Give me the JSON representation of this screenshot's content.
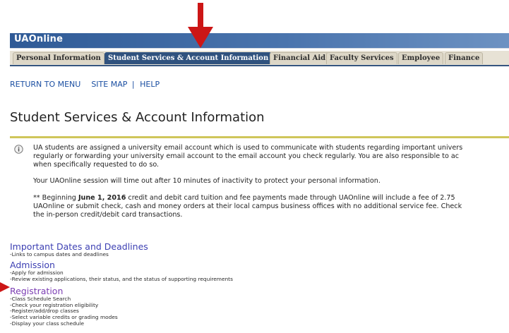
{
  "app": {
    "brand": "UAOnline"
  },
  "tabs": [
    {
      "label": "Personal Information"
    },
    {
      "label": "Student Services & Account Information"
    },
    {
      "label": "Financial Aid"
    },
    {
      "label": "Faculty Services"
    },
    {
      "label": "Employee"
    },
    {
      "label": "Finance"
    }
  ],
  "nav": {
    "return": "RETURN TO MENU",
    "sitemap": "SITE MAP",
    "divider": "|",
    "help": "HELP"
  },
  "page": {
    "title": "Student Services & Account Information"
  },
  "info": {
    "line1": "UA students are assigned a university email account which is used to communicate with students regarding important univers",
    "line2": "regularly or forwarding your university email account to the email account you check regularly. You are also responsible to ac",
    "line3": "when specifically requested to do so.",
    "timeout": "Your UAOnline session will time out after 10 minutes of inactivity to protect your personal information.",
    "notice_pre": "** Beginning ",
    "notice_date": "June 1, 2016",
    "notice_post": " credit and debit card tuition and fee payments made through UAOnline will include a fee of 2.75",
    "notice_line2": "UAOnline or submit check, cash and money orders at their local campus business offices with no additional service fee. Check",
    "notice_line3": "the in-person credit/debit card transactions."
  },
  "menu": [
    {
      "title": "Important Dates and Deadlines",
      "desc": [
        "-Links to campus dates and deadlines"
      ]
    },
    {
      "title": "Admission",
      "desc": [
        "-Apply for admission",
        "-Review existing applications, their status, and the status of supporting requirements"
      ]
    },
    {
      "title": "Registration",
      "desc": [
        "-Class Schedule Search",
        "-Check your registration eligibility",
        "-Register/add/drop classes",
        "-Select variable credits or grading modes",
        "-Display your class schedule"
      ]
    }
  ],
  "colors": {
    "accent_arrow": "#cc1616",
    "header_blue": "#30527e",
    "link_blue": "#1b4fa2",
    "rule_yellow": "#cfc65a"
  }
}
